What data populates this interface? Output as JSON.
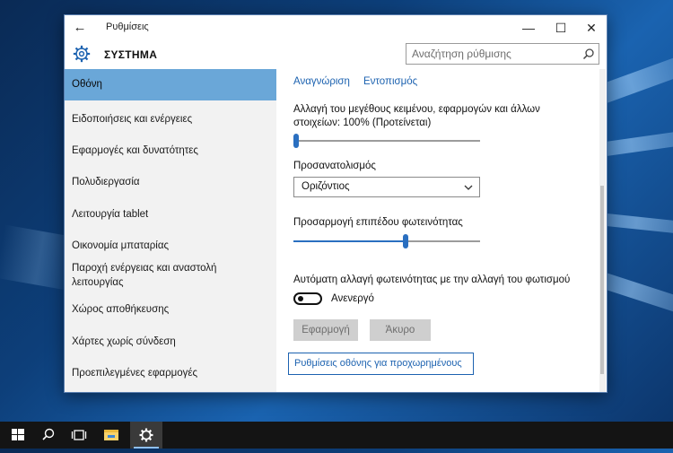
{
  "window": {
    "title": "Ρυθμίσεις",
    "back_glyph": "←",
    "minimize_glyph": "—",
    "maximize_glyph": "☐",
    "close_glyph": "✕"
  },
  "header": {
    "section_title": "ΣΥΣΤΗΜΑ",
    "search_placeholder": "Αναζήτηση ρύθμισης",
    "icon": "gear-icon"
  },
  "nav": {
    "items": [
      {
        "label": "Οθόνη",
        "selected": true
      },
      {
        "label": "Ειδοποιήσεις και ενέργειες",
        "selected": false
      },
      {
        "label": "Εφαρμογές και δυνατότητες",
        "selected": false
      },
      {
        "label": "Πολυδιεργασία",
        "selected": false
      },
      {
        "label": "Λειτουργία tablet",
        "selected": false
      },
      {
        "label": "Οικονομία μπαταρίας",
        "selected": false
      },
      {
        "label": "Παροχή ενέργειας και αναστολή λειτουργίας",
        "selected": false
      },
      {
        "label": "Χώρος αποθήκευσης",
        "selected": false
      },
      {
        "label": "Χάρτες χωρίς σύνδεση",
        "selected": false
      },
      {
        "label": "Προεπιλεγμένες εφαρμογές",
        "selected": false
      }
    ]
  },
  "content": {
    "link_identify": "Αναγνώριση",
    "link_detect": "Εντοπισμός",
    "scale_label": "Αλλαγή του μεγέθους κειμένου, εφαρμογών και άλλων στοιχείων: 100% (Προτείνεται)",
    "scale_slider_value": 0.0,
    "orientation_label": "Προσανατολισμός",
    "orientation_value": "Οριζόντιος",
    "brightness_label": "Προσαρμογή επιπέδου φωτεινότητας",
    "brightness_slider_value": 0.6,
    "auto_brightness_label": "Αυτόματη αλλαγή φωτεινότητας με την αλλαγή του φωτισμού",
    "auto_brightness_state": "Ανενεργό",
    "apply_button": "Εφαρμογή",
    "cancel_button": "Άκυρο",
    "advanced_link": "Ρυθμίσεις οθόνης για προχωρημένους"
  },
  "taskbar": {
    "items": [
      "windows-start-icon",
      "search-icon",
      "task-view-icon",
      "file-explorer-icon",
      "settings-gear-icon"
    ],
    "accent": "#8fbfee"
  },
  "colors": {
    "accent": "#1c62b0",
    "nav_selected": "#6aa7d8"
  }
}
